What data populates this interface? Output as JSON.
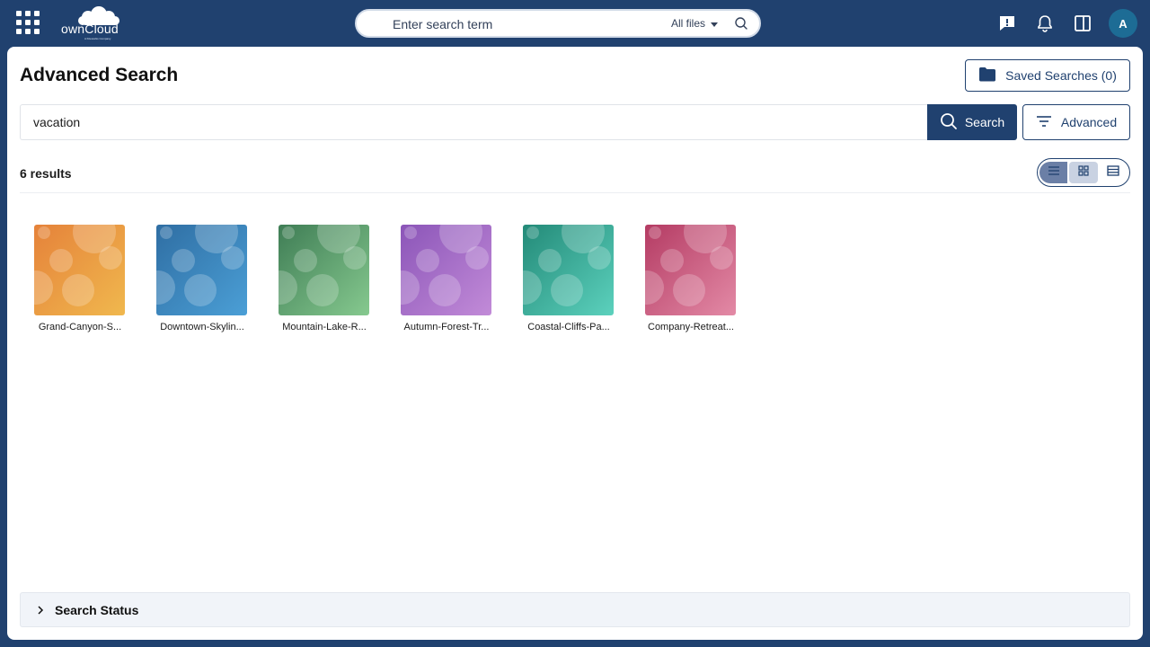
{
  "header": {
    "logo_text": "ownCloud",
    "logo_subtext": "A Kiteworks Company",
    "search": {
      "placeholder": "Enter search term",
      "scope_label": "All files"
    },
    "avatar_initial": "A",
    "icons": [
      "apps-grid-icon",
      "feedback-icon",
      "bell-icon",
      "sidebar-toggle-icon"
    ]
  },
  "page": {
    "title": "Advanced Search",
    "saved_searches_label": "Saved Searches (0)",
    "query_value": "vacation",
    "search_button_label": "Search",
    "advanced_button_label": "Advanced",
    "results_count_label": "6 results",
    "view_modes": [
      "list",
      "grid",
      "table"
    ],
    "status_label": "Search Status"
  },
  "results": [
    {
      "name": "Grand-Canyon-S...",
      "color_a": "#e5823a",
      "color_b": "#f0b84e"
    },
    {
      "name": "Downtown-Skylin...",
      "color_a": "#2f6ea3",
      "color_b": "#4b9fd6"
    },
    {
      "name": "Mountain-Lake-R...",
      "color_a": "#3f7d55",
      "color_b": "#86c98f"
    },
    {
      "name": "Autumn-Forest-Tr...",
      "color_a": "#8b55b8",
      "color_b": "#c28bd8"
    },
    {
      "name": "Coastal-Cliffs-Pa...",
      "color_a": "#238a78",
      "color_b": "#5cd1bd"
    },
    {
      "name": "Company-Retreat...",
      "color_a": "#b43b63",
      "color_b": "#e38aa6"
    }
  ],
  "colors": {
    "brand": "#20416f",
    "avatar": "#1d6c95"
  }
}
